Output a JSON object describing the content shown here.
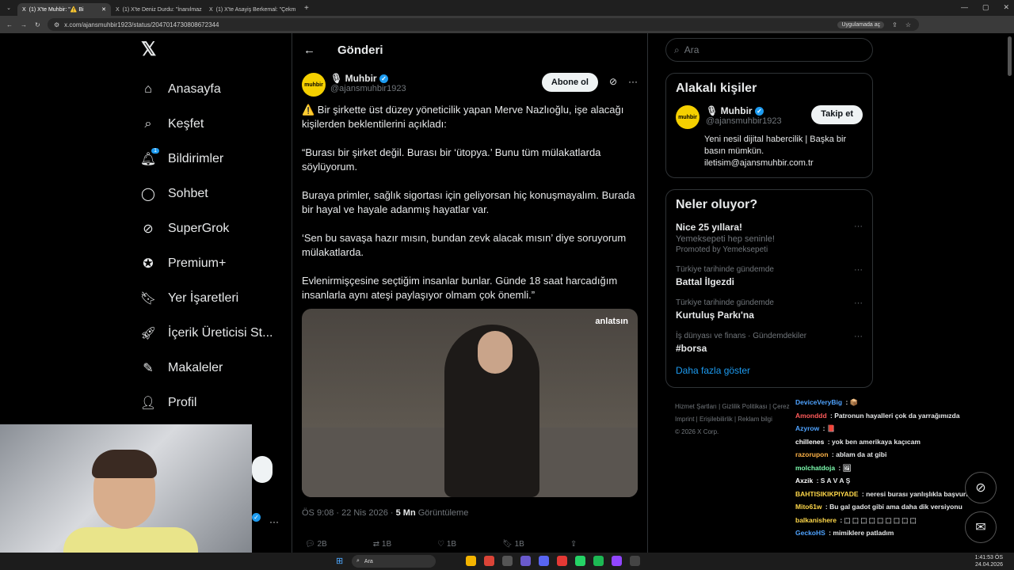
{
  "browser": {
    "tabs": [
      {
        "label": "(1) X'te Muhbir: \"⚠️ Bi"
      },
      {
        "label": "(1) X'te Deniz Durdu: \"İnanılmaz"
      },
      {
        "label": "(1) X'te Asayiş Berkemal: \"Çekm"
      }
    ],
    "new_tab": "+",
    "url": "x.com/ajansmuhbir1923/status/2047014730808672344",
    "open_in_app": "Uygulamada aç"
  },
  "nav": {
    "logo": "𝕏",
    "notif_count": "1",
    "items": [
      "Anasayfa",
      "Keşfet",
      "Bildirimler",
      "Sohbet",
      "SuperGrok",
      "Premium+",
      "Yer İşaretleri",
      "İçerik Üreticisi St...",
      "Makaleler",
      "Profil"
    ]
  },
  "post": {
    "header": "Gönderi",
    "back": "←",
    "author_name": "Muhbir",
    "author_handle": "@ajansmuhbir1923",
    "avatar_text": "muhbir",
    "subscribe": "Abone ol",
    "paragraphs": [
      "⚠️ Bir şirkette üst düzey yöneticilik yapan Merve Nazlıoğlu, işe alacağı kişilerden beklentilerini açıkladı:",
      "“Burası bir şirket değil. Burası bir ‘ütopya.’ Bunu tüm mülakatlarda söylüyorum.",
      "Buraya primler, sağlık sigortası için geliyorsan hiç konuşmayalım. Burada bir hayal ve hayale adanmış hayatlar var.",
      "‘Sen bu savaşa hazır mısın, bundan zevk alacak mısın’ diye soruyorum mülakatlarda.",
      "Evlenirmişçesine seçtiğim insanlar bunlar. Günde 18 saat harcadığım insanlarla aynı ateşi paylaşıyor olmam çok önemli.”"
    ],
    "watermark": "anlatsın",
    "time": "ÖS 9:08 · 22 Nis 2026 · ",
    "views": "5 Mn",
    "views_label": " Görüntüleme",
    "counts": {
      "replies": "2B",
      "reposts": "1B",
      "likes": "1B",
      "bookmarks": "1B"
    }
  },
  "sidebar": {
    "search_placeholder": "Ara",
    "related_title": "Alakalı kişiler",
    "person_name": "Muhbir",
    "person_handle": "@ajansmuhbir1923",
    "follow": "Takip et",
    "bio": "Yeni nesil dijital habercilik | Başka bir basın mümkün. iletisim@ajansmuhbir.com.tr",
    "trends_title": "Neler oluyor?",
    "trends": [
      {
        "cat": "",
        "name": "Nice 25 yıllara!",
        "sub": "Yemeksepeti hep seninle!",
        "promo": "Promoted by Yemeksepeti"
      },
      {
        "cat": "Türkiye tarihinde gündemde",
        "name": "Battal İlgezdi"
      },
      {
        "cat": "Türkiye tarihinde gündemde",
        "name": "Kurtuluş Parkı'na"
      },
      {
        "cat": "İş dünyası ve finans · Gündemdekiler",
        "name": "#borsa"
      }
    ],
    "show_more": "Daha fazla göster",
    "footer1": "Hizmet Şartları  |  Gizlilik Politikası  |  Çerez",
    "footer2": "Imprint  |  Erişilebilirlik  |  Reklam bilgi",
    "copyright": "© 2026 X Corp."
  },
  "chat": [
    {
      "user": "DeviceVeryBig",
      "color": "#4fa3ff",
      "msg": " : 📦"
    },
    {
      "user": "Amonddd",
      "color": "#ff5a5a",
      "msg": " : Patronun hayalleri çok da yarrağımızda"
    },
    {
      "user": "Azyrow",
      "color": "#4fa3ff",
      "msg": " : 📕"
    },
    {
      "user": "chillenes",
      "color": "#ffffff",
      "msg": " : yok ben amerikaya kaçıcam"
    },
    {
      "user": "razorupon",
      "color": "#ffb347",
      "msg": " : ablam da at gibi"
    },
    {
      "user": "molchatdoja",
      "color": "#7dffb0",
      "msg": " : 🖼"
    },
    {
      "user": "Axzik",
      "color": "#ffffff",
      "msg": " : S A V A Ş"
    },
    {
      "user": "BAHTISIKIKPIYADE",
      "color": "#ffd84a",
      "msg": " : neresi burası yanlışlıkla başvurmayalım"
    },
    {
      "user": "Mito61w",
      "color": "#ffd84a",
      "msg": " : Bu gal gadot gibi ama daha dik versiyonu"
    },
    {
      "user": "balkanishere",
      "color": "#ffd84a",
      "msg": " : ⬚ ⬚ ⬚ ⬚ ⬚ ⬚ ⬚ ⬚ ⬚"
    },
    {
      "user": "GeckoHS",
      "color": "#4fa3ff",
      "msg": " : mimiklere patladım"
    }
  ],
  "taskbar": {
    "search": "Ara",
    "time": "1:41:53 ÖS",
    "date": "24.04.2026"
  }
}
